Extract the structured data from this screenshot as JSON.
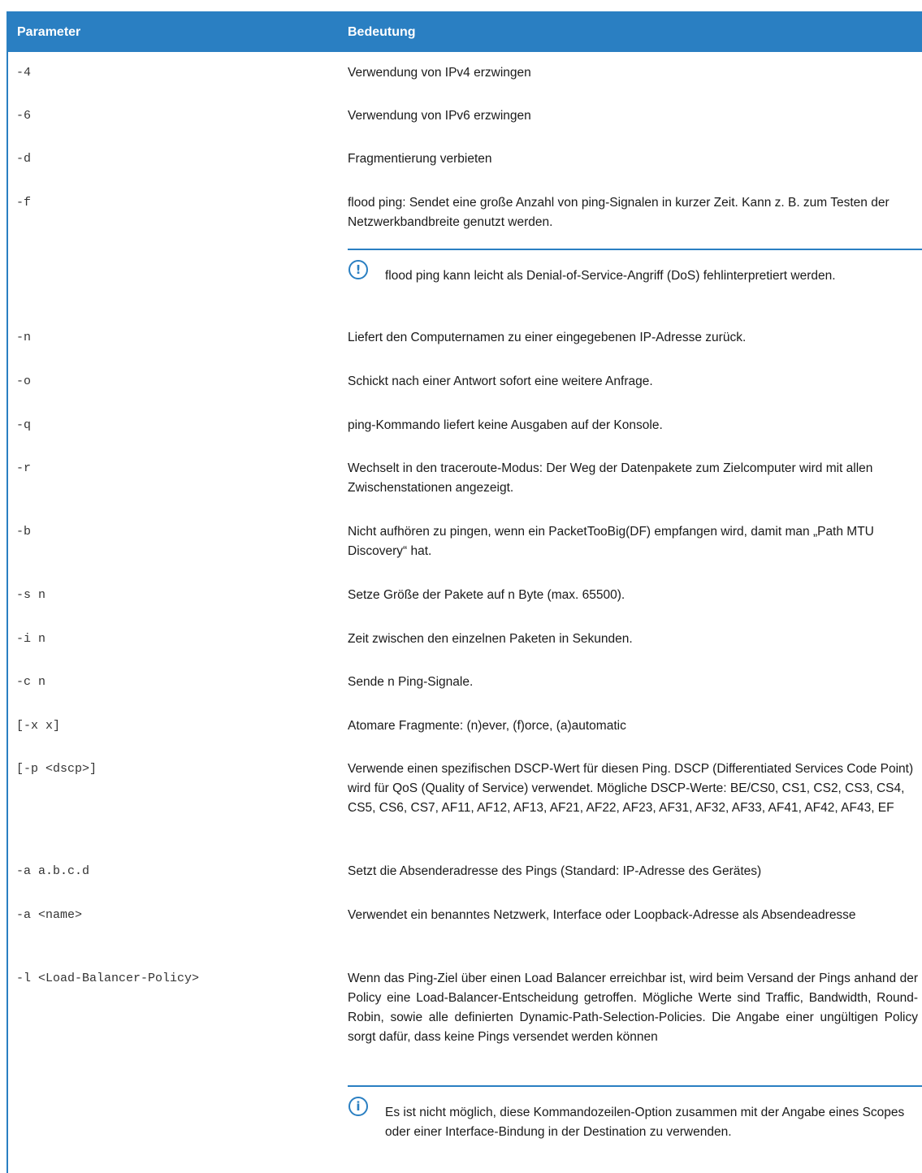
{
  "header": {
    "col_parameter": "Parameter",
    "col_meaning": "Bedeutung"
  },
  "rows": [
    {
      "param": "-4",
      "desc": "Verwendung von IPv4 erzwingen"
    },
    {
      "param": "-6",
      "desc": "Verwendung von IPv6 erzwingen"
    },
    {
      "param": "-d",
      "desc": "Fragmentierung verbieten"
    },
    {
      "param": "-f",
      "desc": "flood ping: Sendet eine große Anzahl von ping-Signalen in kurzer Zeit. Kann z. B. zum Testen der Netzwerkbandbreite genutzt werden.",
      "note_icon": "!",
      "note": "flood ping kann leicht als Denial-of-Service-Angriff (DoS) fehlinterpretiert werden."
    },
    {
      "param": "-n",
      "desc": "Liefert den Computernamen zu einer eingegebenen IP-Adresse zurück."
    },
    {
      "param": "-o",
      "desc": "Schickt nach einer Antwort sofort eine weitere Anfrage."
    },
    {
      "param": "-q",
      "desc": "ping-Kommando liefert keine Ausgaben auf der Konsole."
    },
    {
      "param": "-r",
      "desc": "Wechselt in den traceroute-Modus: Der Weg der Datenpakete zum Zielcomputer wird mit allen Zwischenstationen angezeigt."
    },
    {
      "param": "-b",
      "desc": "Nicht aufhören zu pingen, wenn ein PacketTooBig(DF) empfangen wird, damit man „Path MTU Discovery“ hat."
    },
    {
      "param": "-s n",
      "desc": "Setze Größe der Pakete auf n Byte (max. 65500)."
    },
    {
      "param": "-i n",
      "desc": "Zeit zwischen den einzelnen Paketen in Sekunden."
    },
    {
      "param": "-c n",
      "desc": "Sende n Ping-Signale."
    },
    {
      "param": "[-x x]",
      "desc": "Atomare Fragmente: (n)ever, (f)orce, (a)automatic"
    },
    {
      "param": "[-p <dscp>]",
      "desc": "Verwende einen spezifischen DSCP-Wert für diesen Ping. DSCP (Differentiated Services Code Point) wird für QoS (Quality of Service) verwendet. Mögliche DSCP-Werte: BE/CS0, CS1, CS2, CS3, CS4, CS5, CS6, CS7, AF11, AF12, AF13, AF21, AF22, AF23, AF31, AF32, AF33, AF41, AF42, AF43, EF"
    },
    {
      "param": "-a a.b.c.d",
      "desc": "Setzt die Absenderadresse des Pings (Standard: IP-Adresse des Gerätes)"
    },
    {
      "param": "-a <name>",
      "desc": "Verwendet ein benanntes Netzwerk, Interface oder Loopback-Adresse als Absendeadresse"
    },
    {
      "param": "-l <Load-Balancer-Policy>",
      "desc": "Wenn das Ping-Ziel über einen Load Balancer erreichbar ist, wird beim Versand der Pings anhand der Policy eine Load-Balancer-Entscheidung getroffen. Mögliche Werte sind Traffic, Bandwidth, Round-Robin, sowie alle definierten Dynamic-Path-Selection-Policies. Die Angabe einer ungültigen Policy sorgt dafür, dass keine Pings versendet werden können",
      "note_icon": "i",
      "note": "Es ist nicht möglich, diese Kommandozeilen-Option zusammen mit der Angabe eines Scopes oder einer Interface-Bindung in der Destination zu verwenden."
    }
  ]
}
